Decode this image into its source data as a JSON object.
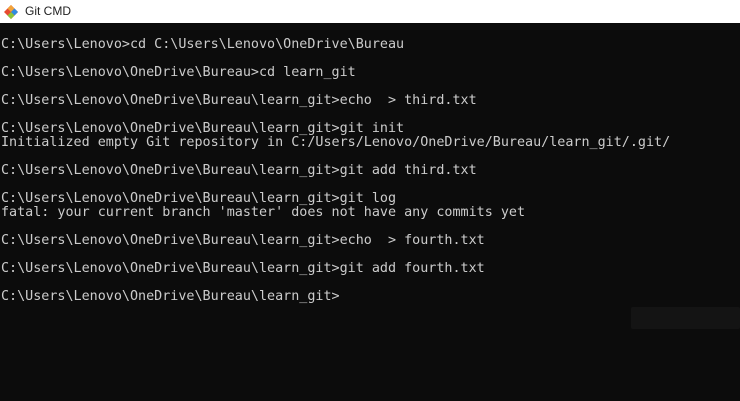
{
  "window": {
    "title": "Git CMD",
    "icon": "git-diamond-icon"
  },
  "console": {
    "lines": [
      "C:\\Users\\Lenovo>cd C:\\Users\\Lenovo\\OneDrive\\Bureau",
      "C:\\Users\\Lenovo\\OneDrive\\Bureau>cd learn_git",
      "C:\\Users\\Lenovo\\OneDrive\\Bureau\\learn_git>echo  > third.txt",
      "C:\\Users\\Lenovo\\OneDrive\\Bureau\\learn_git>git init",
      "Initialized empty Git repository in C:/Users/Lenovo/OneDrive/Bureau/learn_git/.git/",
      "C:\\Users\\Lenovo\\OneDrive\\Bureau\\learn_git>git add third.txt",
      "C:\\Users\\Lenovo\\OneDrive\\Bureau\\learn_git>git log",
      "fatal: your current branch 'master' does not have any commits yet",
      "C:\\Users\\Lenovo\\OneDrive\\Bureau\\learn_git>echo  > fourth.txt",
      "C:\\Users\\Lenovo\\OneDrive\\Bureau\\learn_git>git add fourth.txt",
      "C:\\Users\\Lenovo\\OneDrive\\Bureau\\learn_git>"
    ]
  },
  "colors": {
    "background": "#0c0c0c",
    "text": "#cccccc",
    "titlebar": "#ffffff"
  }
}
